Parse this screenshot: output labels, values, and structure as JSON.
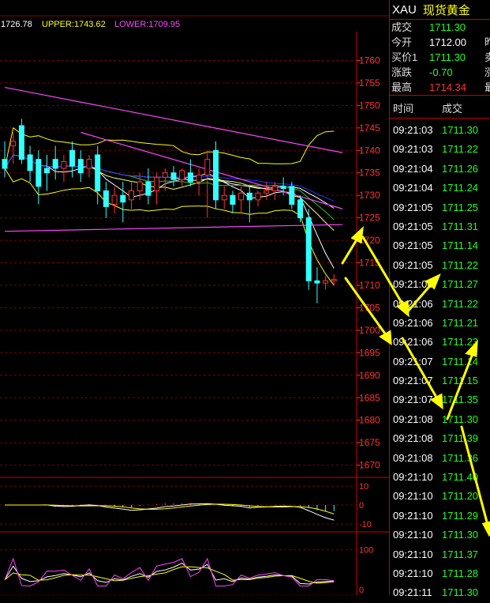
{
  "indicator_header": {
    "mid": "1726.78",
    "upper_label": "UPPER:1743.62",
    "lower_label": "LOWER:1709.95"
  },
  "chart_data": [
    {
      "type": "candlestick",
      "axis": "right",
      "ylim": [
        1668,
        1765
      ],
      "yticks": [
        1760,
        1755,
        1750,
        1745,
        1740,
        1735,
        1730,
        1725,
        1720,
        1715,
        1710,
        1705,
        1700,
        1695,
        1690,
        1685,
        1680,
        1675,
        1670
      ],
      "grid": true,
      "candles": [
        {
          "o": 1738.0,
          "h": 1742.0,
          "l": 1734.0,
          "c": 1736.0
        },
        {
          "o": 1741.0,
          "h": 1744.0,
          "l": 1737.0,
          "c": 1742.0
        },
        {
          "o": 1745.5,
          "h": 1747.0,
          "l": 1737.0,
          "c": 1738.0
        },
        {
          "o": 1739.0,
          "h": 1741.0,
          "l": 1733.0,
          "c": 1735.5
        },
        {
          "o": 1738.0,
          "h": 1740.0,
          "l": 1728.0,
          "c": 1732.0
        },
        {
          "o": 1736.0,
          "h": 1739.0,
          "l": 1731.0,
          "c": 1735.0
        },
        {
          "o": 1738.0,
          "h": 1741.0,
          "l": 1733.5,
          "c": 1736.0
        },
        {
          "o": 1736.0,
          "h": 1739.0,
          "l": 1733.0,
          "c": 1737.5
        },
        {
          "o": 1740.0,
          "h": 1742.0,
          "l": 1734.0,
          "c": 1736.5
        },
        {
          "o": 1738.0,
          "h": 1740.0,
          "l": 1733.0,
          "c": 1735.0
        },
        {
          "o": 1736.0,
          "h": 1739.0,
          "l": 1734.0,
          "c": 1738.0
        },
        {
          "o": 1739.0,
          "h": 1741.0,
          "l": 1728.0,
          "c": 1731.0
        },
        {
          "o": 1731.0,
          "h": 1733.0,
          "l": 1725.0,
          "c": 1727.5
        },
        {
          "o": 1728.0,
          "h": 1732.0,
          "l": 1726.0,
          "c": 1730.0
        },
        {
          "o": 1730.0,
          "h": 1733.0,
          "l": 1724.0,
          "c": 1728.5
        },
        {
          "o": 1729.0,
          "h": 1733.0,
          "l": 1727.0,
          "c": 1731.0
        },
        {
          "o": 1731.0,
          "h": 1735.0,
          "l": 1729.0,
          "c": 1733.0
        },
        {
          "o": 1733.0,
          "h": 1736.0,
          "l": 1728.0,
          "c": 1730.0
        },
        {
          "o": 1731.0,
          "h": 1735.0,
          "l": 1728.0,
          "c": 1734.0
        },
        {
          "o": 1734.0,
          "h": 1736.0,
          "l": 1731.0,
          "c": 1735.0
        },
        {
          "o": 1735.0,
          "h": 1736.5,
          "l": 1732.0,
          "c": 1733.5
        },
        {
          "o": 1733.5,
          "h": 1736.0,
          "l": 1732.0,
          "c": 1735.5
        },
        {
          "o": 1735.0,
          "h": 1738.0,
          "l": 1732.0,
          "c": 1733.0
        },
        {
          "o": 1733.0,
          "h": 1736.0,
          "l": 1730.0,
          "c": 1734.5
        },
        {
          "o": 1734.5,
          "h": 1740.0,
          "l": 1725.0,
          "c": 1738.0
        },
        {
          "o": 1740.0,
          "h": 1742.0,
          "l": 1727.0,
          "c": 1729.0
        },
        {
          "o": 1729.0,
          "h": 1732.0,
          "l": 1727.0,
          "c": 1730.0
        },
        {
          "o": 1730.0,
          "h": 1731.0,
          "l": 1726.0,
          "c": 1728.0
        },
        {
          "o": 1729.0,
          "h": 1732.0,
          "l": 1726.0,
          "c": 1730.5
        },
        {
          "o": 1730.5,
          "h": 1732.0,
          "l": 1724.0,
          "c": 1729.0
        },
        {
          "o": 1729.0,
          "h": 1731.0,
          "l": 1727.5,
          "c": 1730.5
        },
        {
          "o": 1730.5,
          "h": 1733.0,
          "l": 1729.0,
          "c": 1731.0
        },
        {
          "o": 1731.0,
          "h": 1733.0,
          "l": 1729.0,
          "c": 1732.0
        },
        {
          "o": 1732.0,
          "h": 1734.0,
          "l": 1730.0,
          "c": 1731.5
        },
        {
          "o": 1732.0,
          "h": 1733.0,
          "l": 1727.0,
          "c": 1728.0
        },
        {
          "o": 1729.0,
          "h": 1730.0,
          "l": 1724.0,
          "c": 1725.0
        },
        {
          "o": 1725.0,
          "h": 1727.0,
          "l": 1709.0,
          "c": 1711.0
        },
        {
          "o": 1711.0,
          "h": 1714.0,
          "l": 1706.0,
          "c": 1710.5
        },
        {
          "o": 1710.5,
          "h": 1712.0,
          "l": 1709.0,
          "c": 1711.0
        },
        {
          "o": 1711.0,
          "h": 1712.5,
          "l": 1710.0,
          "c": 1711.3
        }
      ],
      "trendlines": [
        {
          "name": "upper-trend",
          "from": [
            0,
            1754.0
          ],
          "to": [
            40,
            1739.5
          ]
        },
        {
          "name": "lower-trend",
          "from": [
            0,
            1722.0
          ],
          "to": [
            40,
            1723.5
          ]
        },
        {
          "name": "mid-trend",
          "from": [
            9,
            1744.0
          ],
          "to": [
            40,
            1727.0
          ]
        }
      ]
    },
    {
      "type": "line",
      "axis": "right",
      "ylim": [
        -13,
        13
      ],
      "yticks": [
        10,
        0,
        -10
      ]
    },
    {
      "type": "line",
      "axis": "right",
      "ylim": [
        0,
        110
      ],
      "yticks": [
        100,
        0
      ]
    }
  ],
  "quote": {
    "symbol": "XAU",
    "name": "现货黄金",
    "rows": [
      {
        "label": "成交",
        "value": "1711.30",
        "color": "green",
        "extra": ""
      },
      {
        "label": "今开",
        "value": "1712.00",
        "color": "white",
        "extra": "昨"
      },
      {
        "label": "买价1",
        "value": "1711.30",
        "color": "green",
        "extra": "卖"
      },
      {
        "label": "涨跌",
        "value": "-0.70",
        "color": "green",
        "extra": "涨"
      },
      {
        "label": "最高",
        "value": "1714.34",
        "color": "red",
        "extra": "最"
      }
    ]
  },
  "ticks_header": {
    "time": "时间",
    "price": "成交"
  },
  "ticks": [
    {
      "time": "09:21:03",
      "price": "1711.30"
    },
    {
      "time": "09:21:03",
      "price": "1711.22"
    },
    {
      "time": "09:21:04",
      "price": "1711.26"
    },
    {
      "time": "09:21:04",
      "price": "1711.24"
    },
    {
      "time": "09:21:05",
      "price": "1711.25"
    },
    {
      "time": "09:21:05",
      "price": "1711.31"
    },
    {
      "time": "09:21:05",
      "price": "1711.14"
    },
    {
      "time": "09:21:05",
      "price": "1711.22"
    },
    {
      "time": "09:21:06",
      "price": "1711.27"
    },
    {
      "time": "09:21:06",
      "price": "1711.22"
    },
    {
      "time": "09:21:06",
      "price": "1711.21"
    },
    {
      "time": "09:21:06",
      "price": "1711.23"
    },
    {
      "time": "09:21:07",
      "price": "1711.14"
    },
    {
      "time": "09:21:07",
      "price": "1711.15"
    },
    {
      "time": "09:21:07",
      "price": "1711.35"
    },
    {
      "time": "09:21:08",
      "price": "1711.30"
    },
    {
      "time": "09:21:08",
      "price": "1711.39"
    },
    {
      "time": "09:21:08",
      "price": "1711.36"
    },
    {
      "time": "09:21:10",
      "price": "1711.40"
    },
    {
      "time": "09:21:10",
      "price": "1711.20"
    },
    {
      "time": "09:21:10",
      "price": "1711.29"
    },
    {
      "time": "09:21:10",
      "price": "1711.30"
    },
    {
      "time": "09:21:10",
      "price": "1711.37"
    },
    {
      "time": "09:21:10",
      "price": "1711.28"
    },
    {
      "time": "09:21:11",
      "price": "1711.30"
    }
  ],
  "colors": {
    "up_candle": "#ff3333",
    "down_candle": "#33ffff",
    "grid": "#7a0000",
    "axis_text": "#ff3333",
    "boll": "#ffff00",
    "trend": "#ff44ff",
    "ma_blue": "#2233ff",
    "ma_green": "#22cc22",
    "arrow": "#ffff00"
  }
}
